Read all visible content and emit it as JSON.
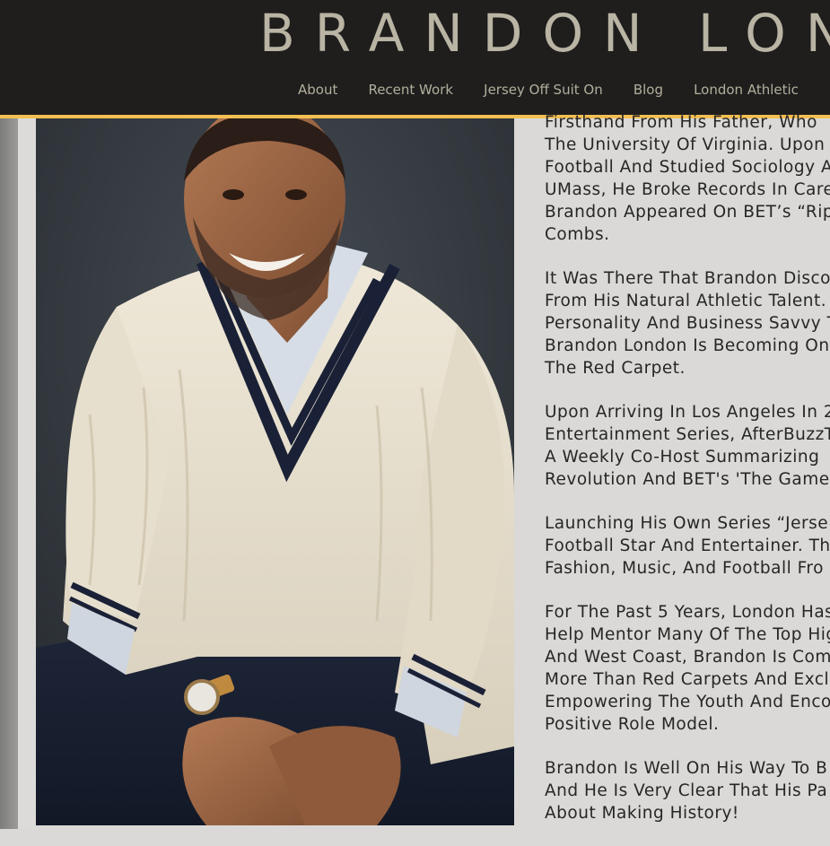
{
  "site": {
    "title": "BRANDON LON"
  },
  "nav": {
    "items": [
      {
        "label": "About"
      },
      {
        "label": "Recent Work"
      },
      {
        "label": "Jersey Off Suit On"
      },
      {
        "label": "Blog"
      },
      {
        "label": "London Athletic"
      }
    ]
  },
  "photo": {
    "subject": "portrait of Brandon London in cream cable-knit sweater"
  },
  "bio": {
    "paragraphs": [
      [
        "Firsthand From His Father, Who",
        "The University Of Virginia. Upon I",
        "Football And Studied Sociology A",
        "UMass, He Broke Records In Care",
        "Brandon Appeared On BET’s “Rip",
        "Combs."
      ],
      [
        "It Was There That Brandon Disco",
        "From His Natural Athletic Talent.",
        "Personality And Business Savvy T",
        "Brandon London Is Becoming On",
        "The Red Carpet."
      ],
      [
        "Upon Arriving In Los Angeles In 2",
        "Entertainment Series, AfterBuzzT",
        "A Weekly Co-Host Summarizing",
        "Revolution And BET's 'The Game"
      ],
      [
        "Launching His Own Series “Jerse",
        "Football Star And Entertainer. Th",
        "Fashion, Music, And Football Fro"
      ],
      [
        "For The Past 5 Years, London Has",
        "Help Mentor Many Of The Top Hig",
        "And West Coast, Brandon Is Com",
        "More Than Red Carpets And Excl",
        "Empowering The Youth And Enco",
        "Positive Role Model."
      ],
      [
        "Brandon Is Well On His Way To B",
        "And He Is Very Clear That His Pa",
        "About Making History!"
      ]
    ]
  },
  "colors": {
    "header_bg": "#1f1e1d",
    "accent_bar": "#f4bf52",
    "title_text": "#b9b4a3",
    "nav_text": "#b3ae9c",
    "page_bg": "#dad9d7",
    "body_text": "#262626"
  }
}
